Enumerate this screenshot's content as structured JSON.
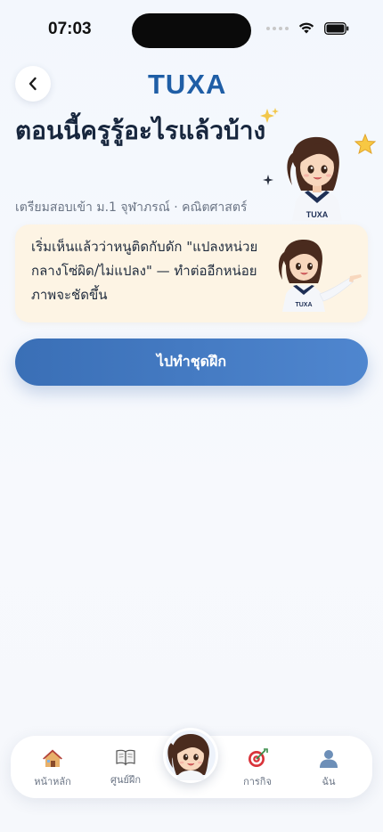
{
  "status_bar": {
    "time": "07:03"
  },
  "header": {
    "logo": "TUXA"
  },
  "page": {
    "title": "ตอนนี้ครูรู้อะไรแล้วบ้าง",
    "subtitle": "เตรียมสอบเข้า ม.1 จุฬาภรณ์ · คณิตศาสตร์"
  },
  "message_card": {
    "text": "เริ่มเห็นแล้วว่าหนูติดกับดัก \"แปลงหน่วยกลางโซ่ผิด/ไม่แปลง\" — ทำต่ออีกหน่อยภาพจะชัดขึ้น"
  },
  "primary_button": {
    "label": "ไปทำชุดฝึก"
  },
  "mascot": {
    "shirt_text": "TUXA"
  },
  "bottom_nav": {
    "items": [
      {
        "label": "หน้าหลัก",
        "icon": "house-icon"
      },
      {
        "label": "ศูนย์ฝึก",
        "icon": "book-icon"
      },
      {
        "label": "การกิจ",
        "icon": "target-icon"
      },
      {
        "label": "ฉัน",
        "icon": "user-icon"
      }
    ]
  },
  "colors": {
    "accent": "#3a6fb6",
    "logo": "#1f5ea6",
    "card_bg": "#fdf4e4",
    "title": "#17263d"
  }
}
